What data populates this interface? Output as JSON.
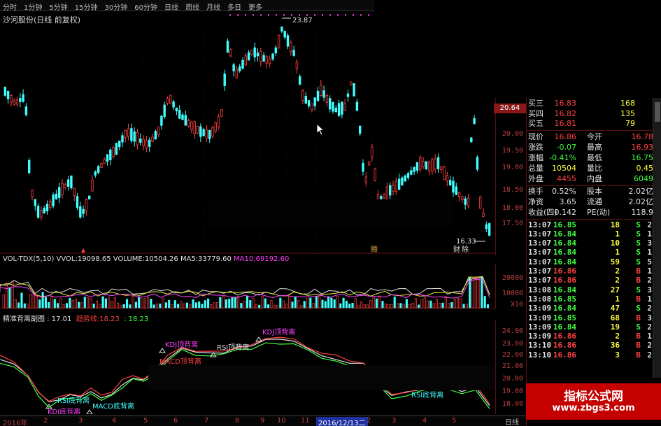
{
  "menu": {
    "items": [
      "分时",
      "1分钟",
      "5分钟",
      "15分钟",
      "30分钟",
      "60分钟",
      "日线",
      "周线",
      "月线",
      "多日",
      "更多"
    ]
  },
  "title": "沙河股份(日线 前复权)",
  "main_chart": {
    "high_label": "23.87",
    "low_label": "16.33",
    "current_price": "20.64",
    "axis_labels": [
      "20.00",
      "19.50",
      "19.00",
      "18.50",
      "18.00",
      "17.50"
    ],
    "event_markers": [
      "腾",
      "财",
      "除"
    ]
  },
  "volume": {
    "header": "VOL-TDX(5,10)",
    "vvol_label": "VVOL:",
    "vvol_value": "19098.65",
    "volume_label": "VOLUME:",
    "volume_value": "10504.26",
    "ma5_label": "MA5:",
    "ma5_value": "33779.60",
    "ma10_label": "MA10:",
    "ma10_value": "69192.60",
    "axis_labels": [
      "20000",
      "10000",
      "X10"
    ]
  },
  "indicator": {
    "header": "精准背离副图 : 17.01",
    "val1_label": "趋势线:",
    "val1_value": "18.23",
    "val2_value": ": 18.23",
    "axis_labels": [
      "24.00",
      "23.00",
      "22.00",
      "21.00",
      "20.00",
      "19.00",
      "18.00"
    ],
    "annotations": [
      "KDJ顶背离",
      "RSI顶背离",
      "MACD顶背离",
      "KDJ顶背离",
      "RSI底背离",
      "MACD底背离",
      "KDJ底背离",
      "RSI底背离"
    ]
  },
  "dates": [
    "2016年",
    "2",
    "3",
    "4",
    "5",
    "6",
    "7",
    "8",
    "9",
    "10",
    "11",
    "12",
    "2016/12/13二",
    "2",
    "3",
    "4",
    "5"
  ],
  "scale_label": "日线",
  "quote": {
    "bids": [
      {
        "label": "买三",
        "price": "16.83",
        "vol": "168"
      },
      {
        "label": "买四",
        "price": "16.82",
        "vol": "135"
      },
      {
        "label": "买五",
        "price": "16.81",
        "vol": "79"
      }
    ],
    "stats": [
      {
        "l1": "现价",
        "v1": "16.86",
        "l2": "今开",
        "v2": "16.78"
      },
      {
        "l1": "涨跌",
        "v1": "-0.07",
        "l2": "最高",
        "v2": "16.93"
      },
      {
        "l1": "涨幅",
        "v1": "-0.41%",
        "l2": "最低",
        "v2": "16.75"
      },
      {
        "l1": "总量",
        "v1": "10504",
        "l2": "量比",
        "v2": "0.45"
      },
      {
        "l1": "外盘",
        "v1": "4455",
        "l2": "内盘",
        "v2": "6049"
      }
    ],
    "stats2": [
      {
        "l1": "换手",
        "v1": "0.52%",
        "l2": "股本",
        "v2": "2.02亿"
      },
      {
        "l1": "净资",
        "v1": "3.65",
        "l2": "流通",
        "v2": "2.02亿"
      },
      {
        "l1": "收益(四)",
        "v1": "0.142",
        "l2": "PE(动)",
        "v2": "118.9"
      }
    ],
    "ticks": [
      {
        "time": "13:07",
        "price": "16.85",
        "vol": "18",
        "side": "S",
        "n": "2"
      },
      {
        "time": "13:07",
        "price": "16.84",
        "vol": "1",
        "side": "S",
        "n": "1"
      },
      {
        "time": "13:07",
        "price": "16.84",
        "vol": "10",
        "side": "S",
        "n": "3"
      },
      {
        "time": "13:07",
        "price": "16.84",
        "vol": "1",
        "side": "S",
        "n": "1"
      },
      {
        "time": "13:07",
        "price": "16.84",
        "vol": "59",
        "side": "S",
        "n": "5"
      },
      {
        "time": "13:07",
        "price": "16.86",
        "vol": "2",
        "side": "B",
        "n": "1"
      },
      {
        "time": "13:07",
        "price": "16.86",
        "vol": "2",
        "side": "B",
        "n": "2"
      },
      {
        "time": "13:08",
        "price": "16.84",
        "vol": "27",
        "side": "S",
        "n": "3"
      },
      {
        "time": "13:08",
        "price": "16.85",
        "vol": "1",
        "side": "B",
        "n": "1"
      },
      {
        "time": "13:09",
        "price": "16.84",
        "vol": "47",
        "side": "S",
        "n": "2"
      },
      {
        "time": "13:09",
        "price": "16.85",
        "vol": "68",
        "side": "B",
        "n": "3"
      },
      {
        "time": "13:09",
        "price": "16.84",
        "vol": "19",
        "side": "S",
        "n": "2"
      },
      {
        "time": "13:09",
        "price": "16.86",
        "vol": "2",
        "side": "B",
        "n": "1"
      },
      {
        "time": "13:10",
        "price": "16.86",
        "vol": "36",
        "side": "B",
        "n": "2"
      },
      {
        "time": "13:10",
        "price": "16.86",
        "vol": "3",
        "side": "B",
        "n": "2"
      }
    ]
  },
  "watermark": {
    "title": "指标公式网",
    "url": "www.zbgs3.com"
  },
  "colors": {
    "up": "#ff4040",
    "down": "#40ffff",
    "bg": "#000000",
    "grid": "#5a1010",
    "accent": "#c40000"
  }
}
